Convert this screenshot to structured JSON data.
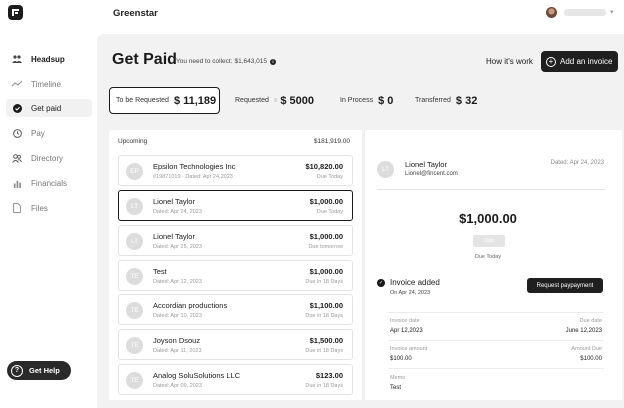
{
  "app": {
    "org_name": "Greenstar"
  },
  "sidebar": {
    "items": [
      {
        "label": "Headsup"
      },
      {
        "label": "Timeline"
      },
      {
        "label": "Get paid"
      },
      {
        "label": "Pay"
      },
      {
        "label": "Directory"
      },
      {
        "label": "Financials"
      },
      {
        "label": "Files"
      }
    ],
    "help_label": "Get Help"
  },
  "header": {
    "title": "Get Paid",
    "collect_text": "You need to collect:",
    "collect_value": "$1,643,015",
    "how_link": "How it's work",
    "add_invoice": "Add an invoice"
  },
  "stats": [
    {
      "label": "To be Requested",
      "value": "$ 11,189",
      "active": true
    },
    {
      "label": "Requested",
      "value": "$ 5000",
      "active": false
    },
    {
      "label": "In Process",
      "value": "$ 0",
      "active": false
    },
    {
      "label": "Transferred",
      "value": "$ 32",
      "active": false
    }
  ],
  "upcoming": {
    "header": "Upcoming",
    "total": "$181,919.00",
    "rows": [
      {
        "initials": "EP",
        "name": "Epsilon Technologies Inc",
        "dated": "#19871019 · Dated: Apr 24,2023",
        "amount": "$10,820.00",
        "due": "Due Today"
      },
      {
        "initials": "LT",
        "name": "Lionel Taylor",
        "dated": "Dated: Apr 24, 2023",
        "amount": "$1,000.00",
        "due": "Due Today"
      },
      {
        "initials": "LT",
        "name": "Lionel Taylor",
        "dated": "Dated: Apr 25, 2023",
        "amount": "$1,000.00",
        "due": "Due tomorrow"
      },
      {
        "initials": "TE",
        "name": "Test",
        "dated": "Dated: Apr 12, 2023",
        "amount": "$1,000.00",
        "due": "Due in 18 Days"
      },
      {
        "initials": "TE",
        "name": "Accordian productions",
        "dated": "Dated: Apr 10, 2023",
        "amount": "$1,100.00",
        "due": "Due in 18 Days"
      },
      {
        "initials": "TE",
        "name": "Joyson Dsouz",
        "dated": "Dated: Apr 11, 2023",
        "amount": "$1,500.00",
        "due": "Due in 18 Days"
      },
      {
        "initials": "TE",
        "name": "Analog SoluSolutions LLC",
        "dated": "Dated: Apr 09, 2023",
        "amount": "$123.00",
        "due": "Due in 18 Days"
      }
    ]
  },
  "detail": {
    "initials": "LT",
    "name": "Lionel Taylor",
    "email": "Lionel@fincent.com",
    "dated": "Dated: Apr 24, 2023",
    "amount": "$1,000.00",
    "due_pill": "Due",
    "due_text": "Due Today",
    "status_title": "Invoice added",
    "status_date": "On Apr 24, 2023",
    "request_button": "Request paypayment",
    "invoice_date_label": "Invoice date",
    "invoice_date": "Apr 12,2023",
    "due_date_label": "Due date",
    "due_date": "June 12,2023",
    "invoice_amount_label": "Invoice amount",
    "invoice_amount": "$100.00",
    "amount_due_label": "Amount Due",
    "amount_due": "$100.00",
    "memo_label": "Memo",
    "memo": "Test"
  }
}
